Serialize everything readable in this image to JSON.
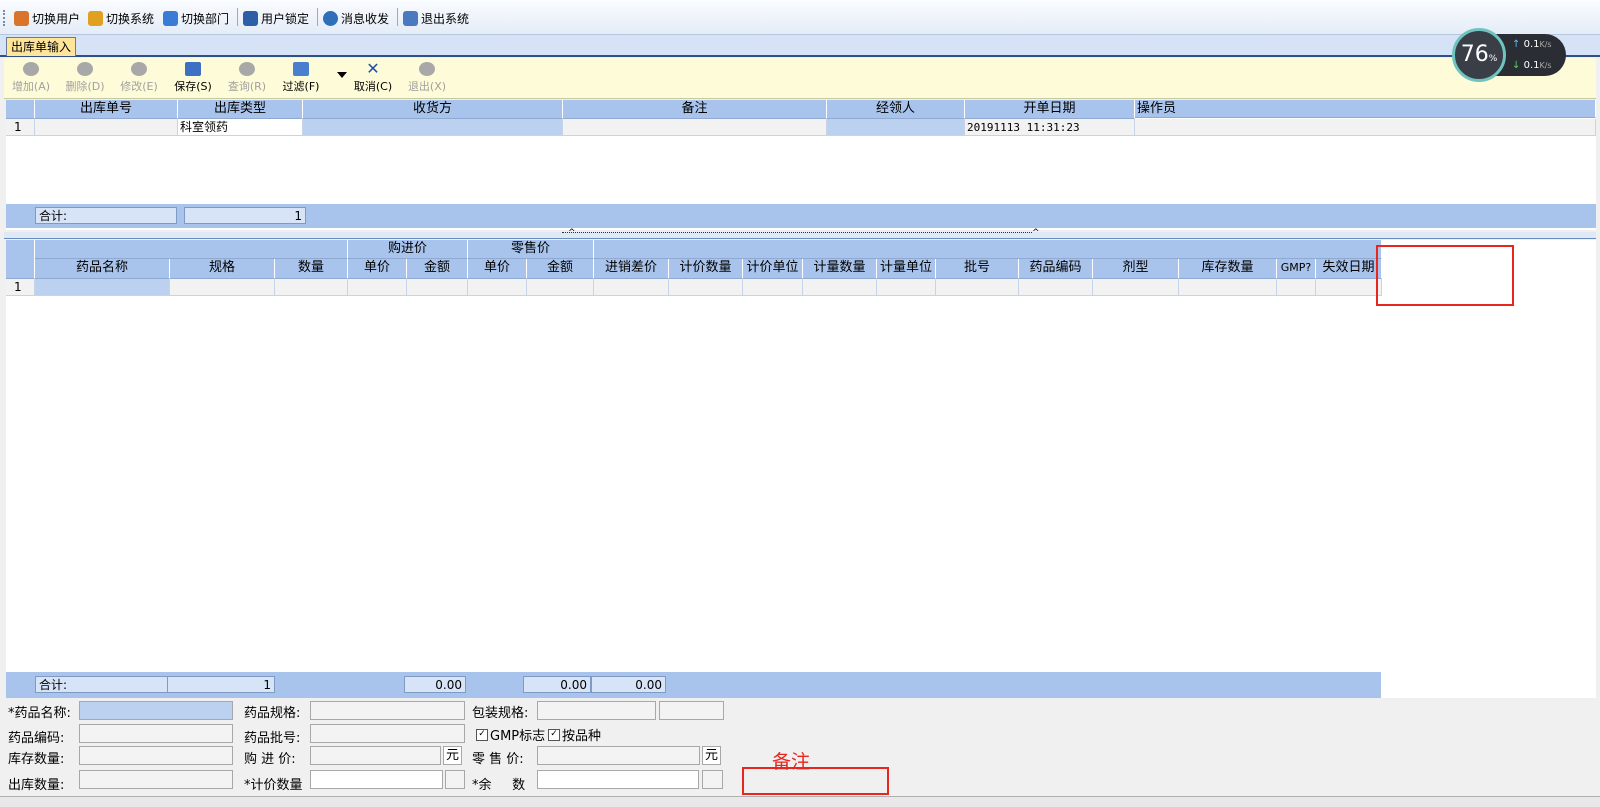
{
  "menu": {
    "items": [
      {
        "label": "切换用户",
        "icon": "switch-user-icon",
        "color": "#d9742b"
      },
      {
        "label": "切换系统",
        "icon": "switch-system-icon",
        "color": "#e0a020"
      },
      {
        "label": "切换部门",
        "icon": "switch-department-icon",
        "color": "#3a7bd5"
      },
      {
        "label": "用户锁定",
        "icon": "user-lock-icon",
        "color": "#2d5fa8"
      },
      {
        "label": "消息收发",
        "icon": "message-icon",
        "color": "#2d6fb8"
      },
      {
        "label": "退出系统",
        "icon": "exit-icon",
        "color": "#4a79c0"
      }
    ]
  },
  "tab": {
    "label": "出库单输入"
  },
  "toolbar": {
    "add": "增加(A)",
    "delete": "删除(D)",
    "modify": "修改(E)",
    "save": "保存(S)",
    "query": "查询(R)",
    "filter": "过滤(F)",
    "cancel": "取消(C)",
    "exit": "退出(X)"
  },
  "master_grid": {
    "columns": [
      "出库单号",
      "出库类型",
      "收货方",
      "备注",
      "经领人",
      "开单日期",
      "操作员"
    ],
    "rows": [
      {
        "num": "1",
        "order_no": "",
        "type": "科室领药",
        "receiver": "",
        "remark": "",
        "handler": "",
        "date": "20191113 11:31:23",
        "operator": ""
      }
    ],
    "summary_label": "合计:",
    "summary_count": "1"
  },
  "detail_grid": {
    "group_headers": {
      "purchase": "购进价",
      "retail": "零售价"
    },
    "columns": [
      "药品名称",
      "规格",
      "数量",
      "单价",
      "金额",
      "单价",
      "金额",
      "进销差价",
      "计价数量",
      "计价单位",
      "计量数量",
      "计量单位",
      "批号",
      "药品编码",
      "剂型",
      "库存数量",
      "GMP?",
      "失效日期"
    ],
    "rows": [
      {
        "num": "1"
      }
    ],
    "summary_label": "合计:",
    "summary_count": "1",
    "summary_purchase_amount": "0.00",
    "summary_retail_amount": "0.00",
    "summary_diff": "0.00"
  },
  "form": {
    "drug_name_label": "*药品名称:",
    "drug_spec_label": "药品规格:",
    "package_spec_label": "包装规格:",
    "drug_code_label": "药品编码:",
    "drug_batch_label": "药品批号:",
    "gmp_label": "GMP标志",
    "by_variety_label": "按品种",
    "stock_qty_label": "库存数量:",
    "purchase_price_label": "购 进 价:",
    "retail_price_label": "零 售 价:",
    "unit_yuan": "元",
    "out_qty_label": "出库数量:",
    "pricing_qty_label": "*计价数量",
    "remain_label": "*余     数",
    "annotation": "备注"
  },
  "speed_widget": {
    "percent": "76",
    "unit": "%",
    "up": "0.1",
    "down": "0.1",
    "rate_unit": "K/s"
  },
  "colors": {
    "header_blue": "#a9c4ec",
    "toolbar_yellow": "#fefcd8",
    "annotation_red": "#e8261d"
  }
}
